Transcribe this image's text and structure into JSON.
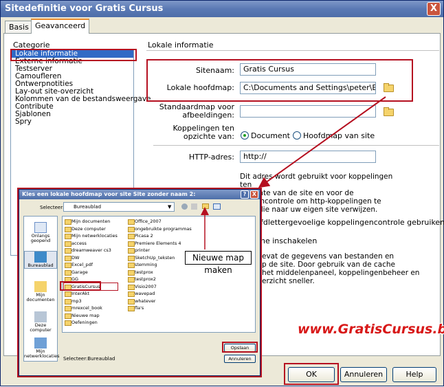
{
  "window": {
    "title": "Sitedefinitie voor Gratis Cursus",
    "close_label": "X"
  },
  "tabs": [
    {
      "label": "Basis",
      "active": false
    },
    {
      "label": "Geavanceerd",
      "active": true
    }
  ],
  "categories": {
    "title": "Categorie",
    "items": [
      "Lokale informatie",
      "Externe informatie",
      "Testserver",
      "Camoufleren",
      "Ontwerpnotities",
      "Lay-out site-overzicht",
      "Kolommen van de bestandsweergave",
      "Contribute",
      "Sjablonen",
      "Spry"
    ],
    "selected_index": 0
  },
  "section": {
    "title": "Lokale informatie",
    "site_name_label": "Sitenaam:",
    "site_name_value": "Gratis Cursus",
    "root_folder_label": "Lokale hoofdmap:",
    "root_folder_value": "C:\\Documents and Settings\\peter\\Bureau",
    "images_folder_label_1": "Standaardmap voor",
    "images_folder_label_2": "afbeeldingen:",
    "images_folder_value": "",
    "links_label_1": "Koppelingen ten",
    "links_label_2": "opzichte van:",
    "links_options": [
      "Document",
      "Hoofdmap van site"
    ],
    "links_selected": 0,
    "http_label": "HTTP-adres:",
    "http_value": "http://",
    "help_lines": [
      "Dit adres wordt gebruikt voor koppelingen ten",
      "opzichte van de site en voor de",
      "gingencontrole om http-koppelingen te",
      "eren die naar uw eigen site verwijzen."
    ],
    "case_text": "fdlettergevoelige koppelingencontrole gebruiken",
    "cache_text": "he inschakelen",
    "cache_help_lines": [
      "evat de gegevens van bestanden en",
      "p de site.  Door gebruik van de cache",
      "het middelenpaneel, koppelingenbeheer en",
      "erzicht sneller."
    ]
  },
  "buttons": {
    "ok": "OK",
    "cancel": "Annuleren",
    "help": "Help"
  },
  "dialog": {
    "title": "Kies een lokale hoofdmap voor site Site zonder naam 2:",
    "help_btn": "?",
    "close_btn": "X",
    "look_in_label": "Selecteer:",
    "look_in_value": "Bureaublad",
    "places": [
      "Onlangs geopend",
      "Bureaublad",
      "Mijn documenten",
      "Deze computer",
      "Mijn netwerklocaties"
    ],
    "files_col1": [
      "Mijn documenten",
      "Deze computer",
      "Mijn netwerklocaties",
      "access",
      "dreamweaver cs3",
      "DW",
      "Excel_pdf",
      "Garage",
      "GG",
      "GratisCursus",
      "InterAkt",
      "mp3",
      "mrexcel_book",
      "Nieuwe map",
      "Oefeningen"
    ],
    "files_col2": [
      "Office_2007",
      "ongebruikte programmas",
      "Picasa 2",
      "Premiere Elements 4",
      "printer",
      "SketchUp_teksten",
      "stemming",
      "testprox",
      "testprox2",
      "Visio2007",
      "wavepad",
      "whatever",
      "fla's"
    ],
    "selection_label": "Selecteer:Bureaublad",
    "open_btn": "Opslaan",
    "cancel_btn": "Annuleren"
  },
  "callout": "Nieuwe map maken",
  "watermark": "www.GratisCursus.be",
  "colors": {
    "highlight": "#b51020",
    "title_bar": "#5a79b4",
    "selection": "#316ac5"
  }
}
